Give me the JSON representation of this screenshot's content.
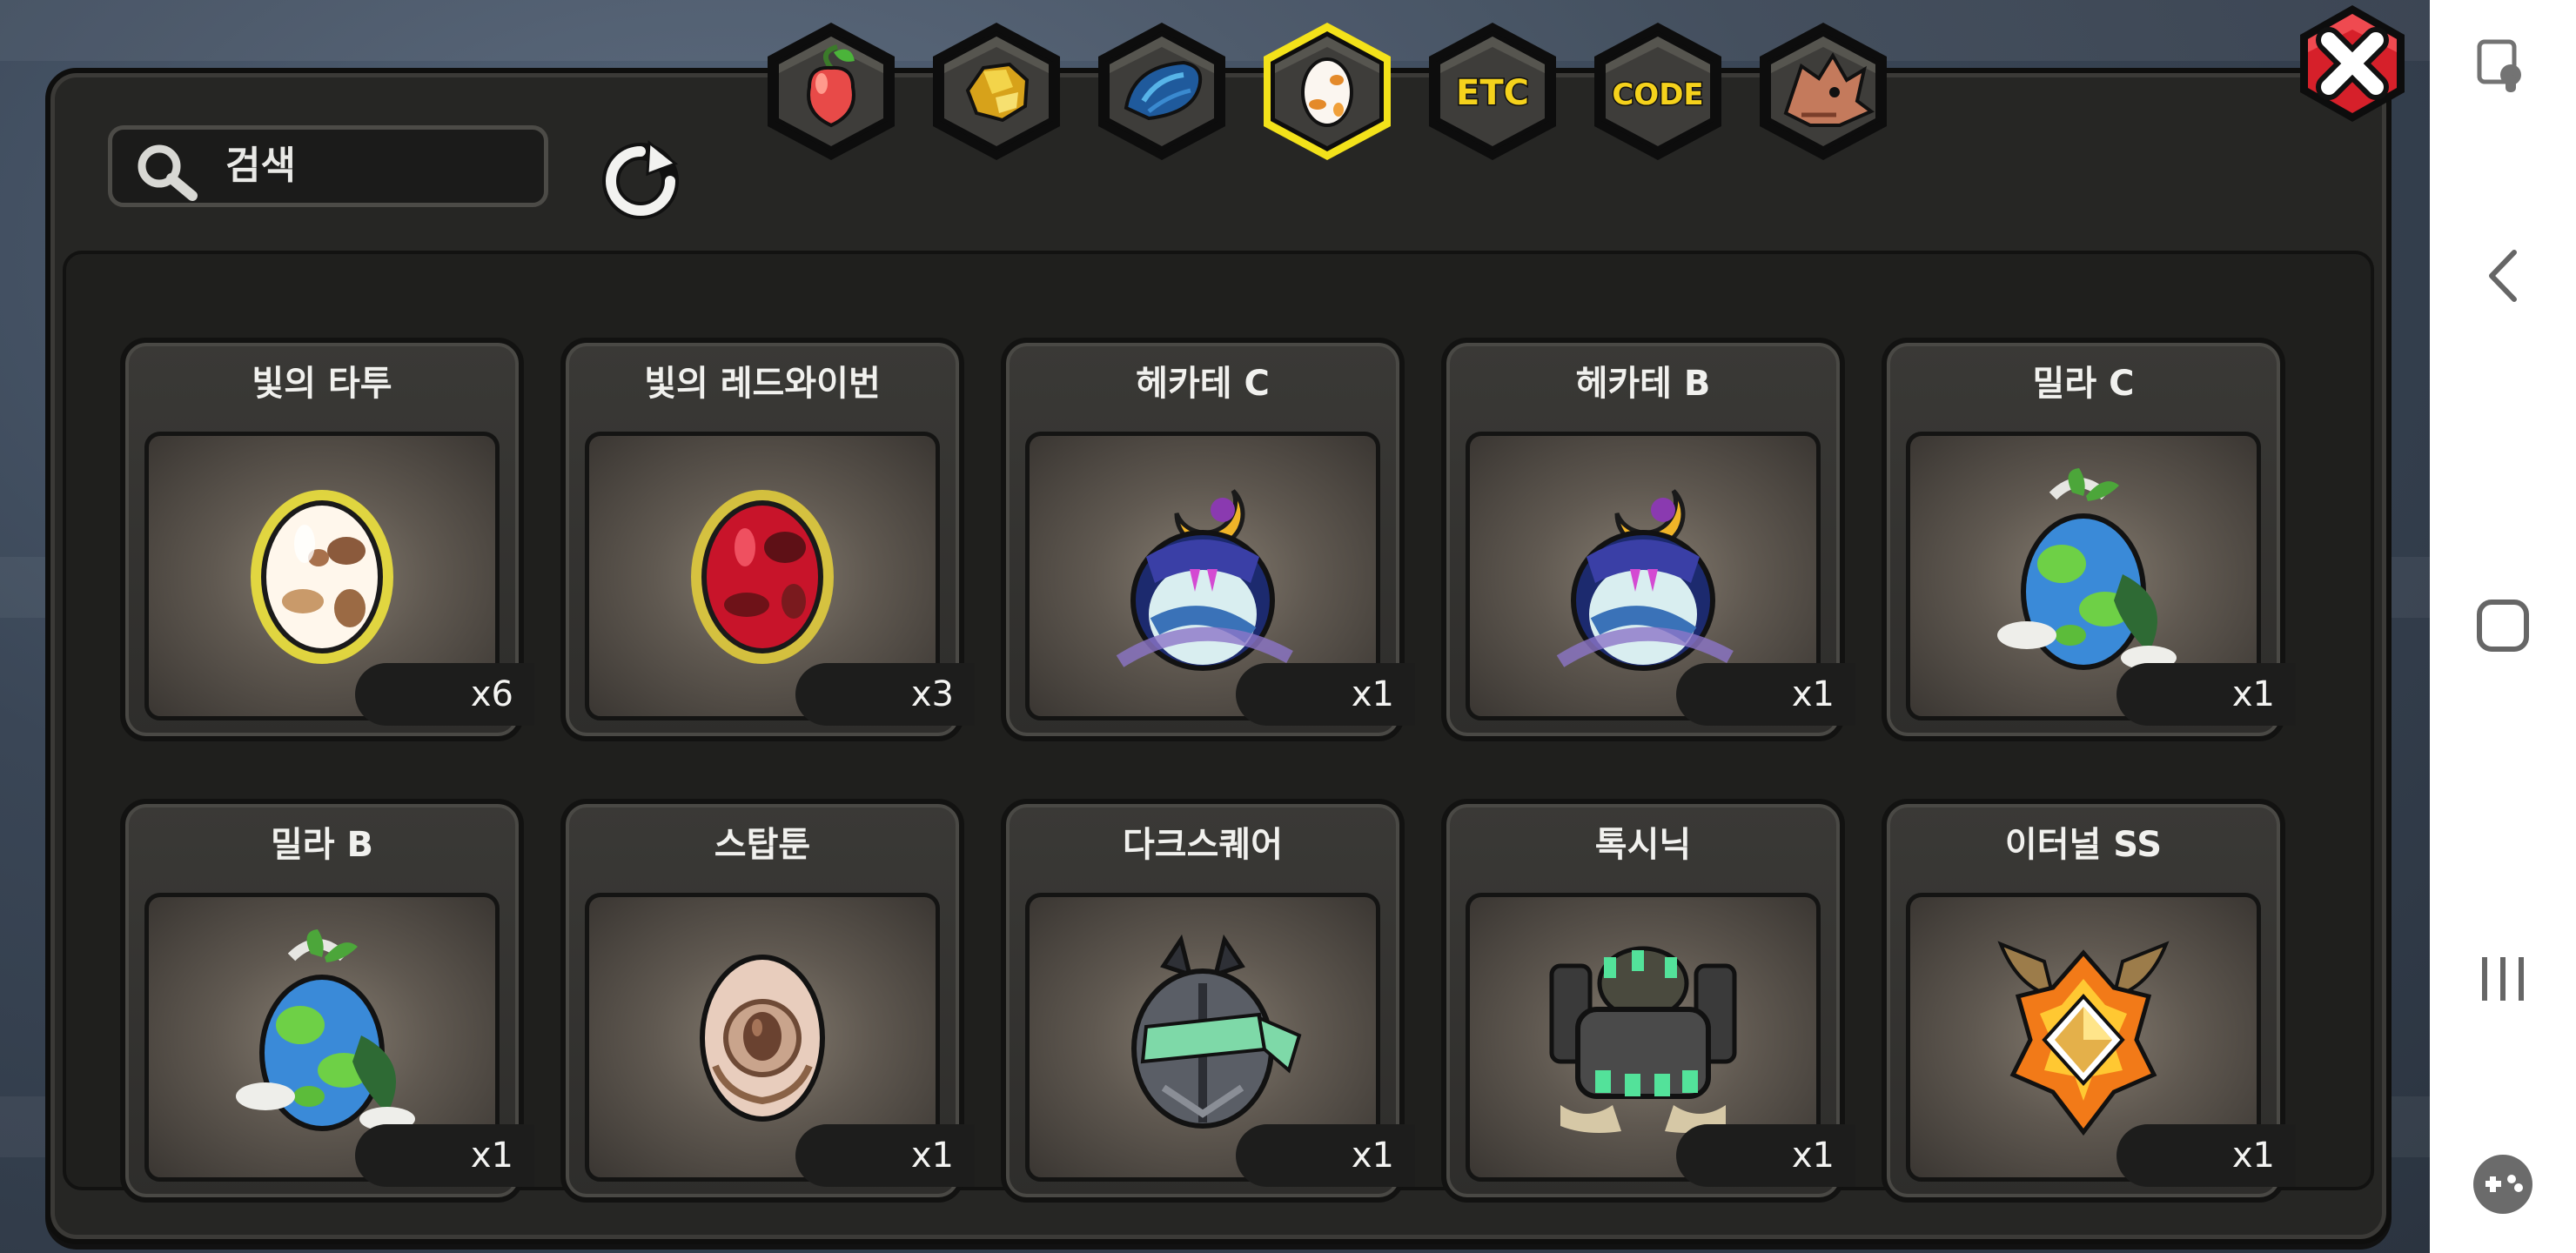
{
  "search": {
    "placeholder": "검색"
  },
  "tabs": [
    {
      "id": "fruit",
      "icon": "fruit-icon",
      "label": ""
    },
    {
      "id": "gold",
      "icon": "gold-ore-icon",
      "label": ""
    },
    {
      "id": "dragon-scale",
      "icon": "scale-icon",
      "label": ""
    },
    {
      "id": "egg",
      "icon": "egg-icon",
      "label": "",
      "selected": true
    },
    {
      "id": "etc",
      "icon": "etc-icon",
      "label": "ETC"
    },
    {
      "id": "code",
      "icon": "code-icon",
      "label": "CODE"
    },
    {
      "id": "dragon",
      "icon": "dragon-head-icon",
      "label": ""
    }
  ],
  "items": [
    {
      "name": "빛의 타투",
      "count": "x6",
      "icon": "white-glowing-egg-icon"
    },
    {
      "name": "빛의 레드와이번",
      "count": "x3",
      "icon": "red-glowing-egg-icon"
    },
    {
      "name": "헤카테 C",
      "count": "x1",
      "icon": "hecate-egg-icon"
    },
    {
      "name": "헤카테 B",
      "count": "x1",
      "icon": "hecate-egg-icon"
    },
    {
      "name": "밀라 C",
      "count": "x1",
      "icon": "mila-egg-icon"
    },
    {
      "name": "밀라 B",
      "count": "x1",
      "icon": "mila-egg-icon"
    },
    {
      "name": "스탑툰",
      "count": "x1",
      "icon": "stone-egg-icon"
    },
    {
      "name": "다크스퀘어",
      "count": "x1",
      "icon": "dark-armored-egg-icon"
    },
    {
      "name": "톡시닉",
      "count": "x1",
      "icon": "toxic-machine-egg-icon"
    },
    {
      "name": "이터널 SS",
      "count": "x1",
      "icon": "eternal-crystal-egg-icon"
    }
  ],
  "colors": {
    "selected_tab_border": "#f3e21a",
    "close_button": "#d6202a",
    "tab_text": "#f5d21c"
  }
}
